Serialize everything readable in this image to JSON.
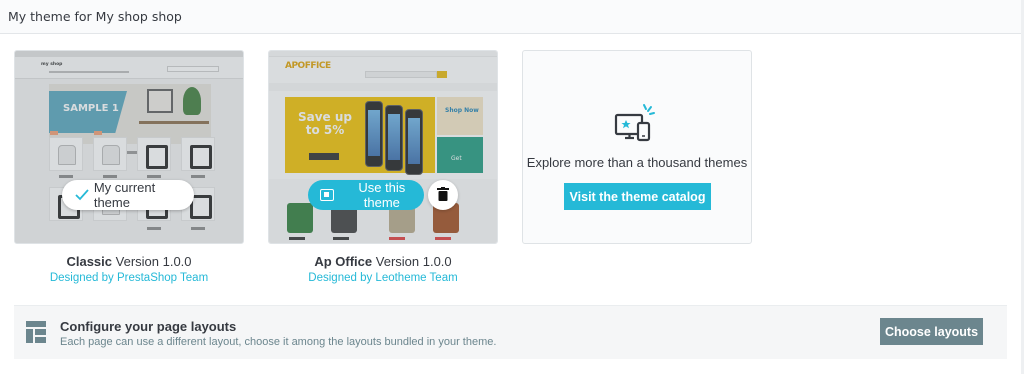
{
  "header": {
    "title": "My theme for My shop shop"
  },
  "themes": [
    {
      "name": "Classic",
      "version_label": "Version 1.0.0",
      "designer_label": "Designed by PrestaShop Team",
      "action_label": "My current theme",
      "preview": {
        "logo": "my shop",
        "banner_text": "SAMPLE 1"
      }
    },
    {
      "name": "Ap Office",
      "version_label": "Version 1.0.0",
      "designer_label": "Designed by Leotheme Team",
      "action_label": "Use this theme",
      "preview": {
        "logo": "APOFFICE",
        "hero_text": "Save up to 5%",
        "side_text_1": "Shop Now",
        "side_text_2": "Get"
      }
    }
  ],
  "explore": {
    "text": "Explore more than a thousand themes",
    "button_label": "Visit the theme catalog"
  },
  "layouts": {
    "title": "Configure your page layouts",
    "description": "Each page can use a different layout, choose it among the layouts bundled in your theme.",
    "button_label": "Choose layouts"
  },
  "icons": {
    "current": "check-icon",
    "use": "monitor-icon",
    "delete": "trash-icon",
    "explore": "devices-icon",
    "layouts": "layout-grid-icon"
  },
  "colors": {
    "accent": "#25b9d7",
    "button_secondary": "#6c868e",
    "text": "#363a41"
  }
}
